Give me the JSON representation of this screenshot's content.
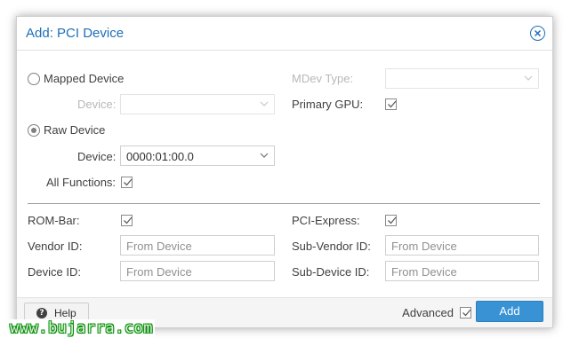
{
  "dialog": {
    "title": "Add: PCI Device"
  },
  "left": {
    "mapped_device_label": "Mapped Device",
    "device_label_disabled": "Device:",
    "raw_device_label": "Raw Device",
    "device_label": "Device:",
    "device_value": "0000:01:00.0",
    "all_functions_label": "All Functions:",
    "all_functions_checked": true
  },
  "right": {
    "mdev_type_label": "MDev Type:",
    "mdev_type_value": "",
    "primary_gpu_label": "Primary GPU:",
    "primary_gpu_checked": true
  },
  "advanced_section": {
    "rom_bar_label": "ROM-Bar:",
    "rom_bar_checked": true,
    "vendor_id_label": "Vendor ID:",
    "vendor_id_placeholder": "From Device",
    "device_id_label": "Device ID:",
    "device_id_placeholder": "From Device",
    "pci_express_label": "PCI-Express:",
    "pci_express_checked": true,
    "sub_vendor_id_label": "Sub-Vendor ID:",
    "sub_vendor_id_placeholder": "From Device",
    "sub_device_id_label": "Sub-Device ID:",
    "sub_device_id_placeholder": "From Device"
  },
  "footer": {
    "help_label": "Help",
    "advanced_label": "Advanced",
    "advanced_checked": true,
    "add_label": "Add"
  },
  "watermark": "www.bujarra.com",
  "colors": {
    "accent": "#1e6fb8",
    "button": "#3892d4"
  }
}
